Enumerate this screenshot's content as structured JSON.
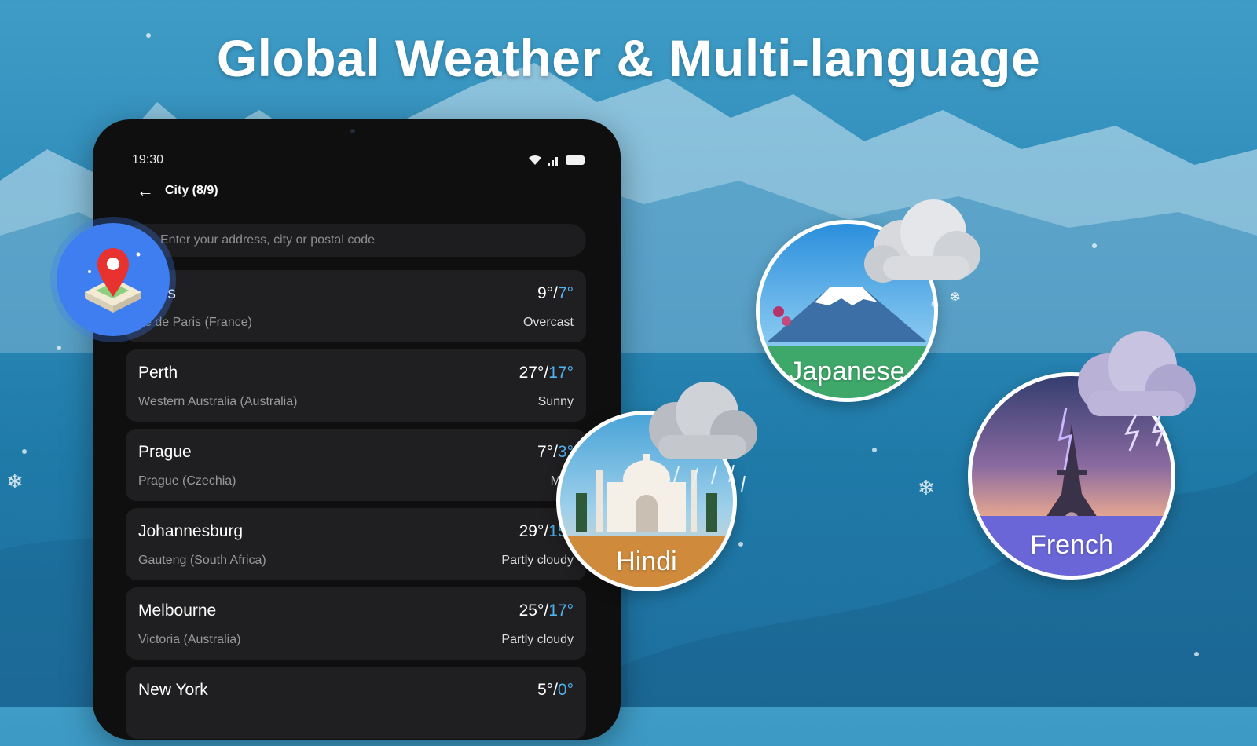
{
  "headline": "Global Weather & Multi-language",
  "status_bar": {
    "time": "19:30"
  },
  "top_bar": {
    "title": "City (8/9)"
  },
  "search": {
    "placeholder": "Enter your address, city or postal code"
  },
  "cities": [
    {
      "name": "Paris",
      "region": "Île de Paris (France)",
      "high": "9°",
      "low": "7°",
      "condition": "Overcast"
    },
    {
      "name": "Perth",
      "region": "Western Australia (Australia)",
      "high": "27°",
      "low": "17°",
      "condition": "Sunny"
    },
    {
      "name": "Prague",
      "region": "Prague (Czechia)",
      "high": "7°",
      "low": "3°",
      "condition": "Mist"
    },
    {
      "name": "Johannesburg",
      "region": "Gauteng (South Africa)",
      "high": "29°",
      "low": "15°",
      "condition": "Partly cloudy"
    },
    {
      "name": "Melbourne",
      "region": "Victoria (Australia)",
      "high": "25°",
      "low": "17°",
      "condition": "Partly cloudy"
    },
    {
      "name": "New York",
      "region": "",
      "high": "5°",
      "low": "0°",
      "condition": ""
    }
  ],
  "temp_separator": "/",
  "languages": [
    {
      "label": "Japanese",
      "color": "#3ea86a"
    },
    {
      "label": "Hindi",
      "color": "#d08a3c"
    },
    {
      "label": "French",
      "color": "#6a66d8"
    }
  ],
  "colors": {
    "background": "#2d8ab8",
    "tablet": "#0f0f10",
    "card": "#1f1f21",
    "low_temp": "#4fb3f0",
    "location_badge": "#3e7ef0"
  }
}
